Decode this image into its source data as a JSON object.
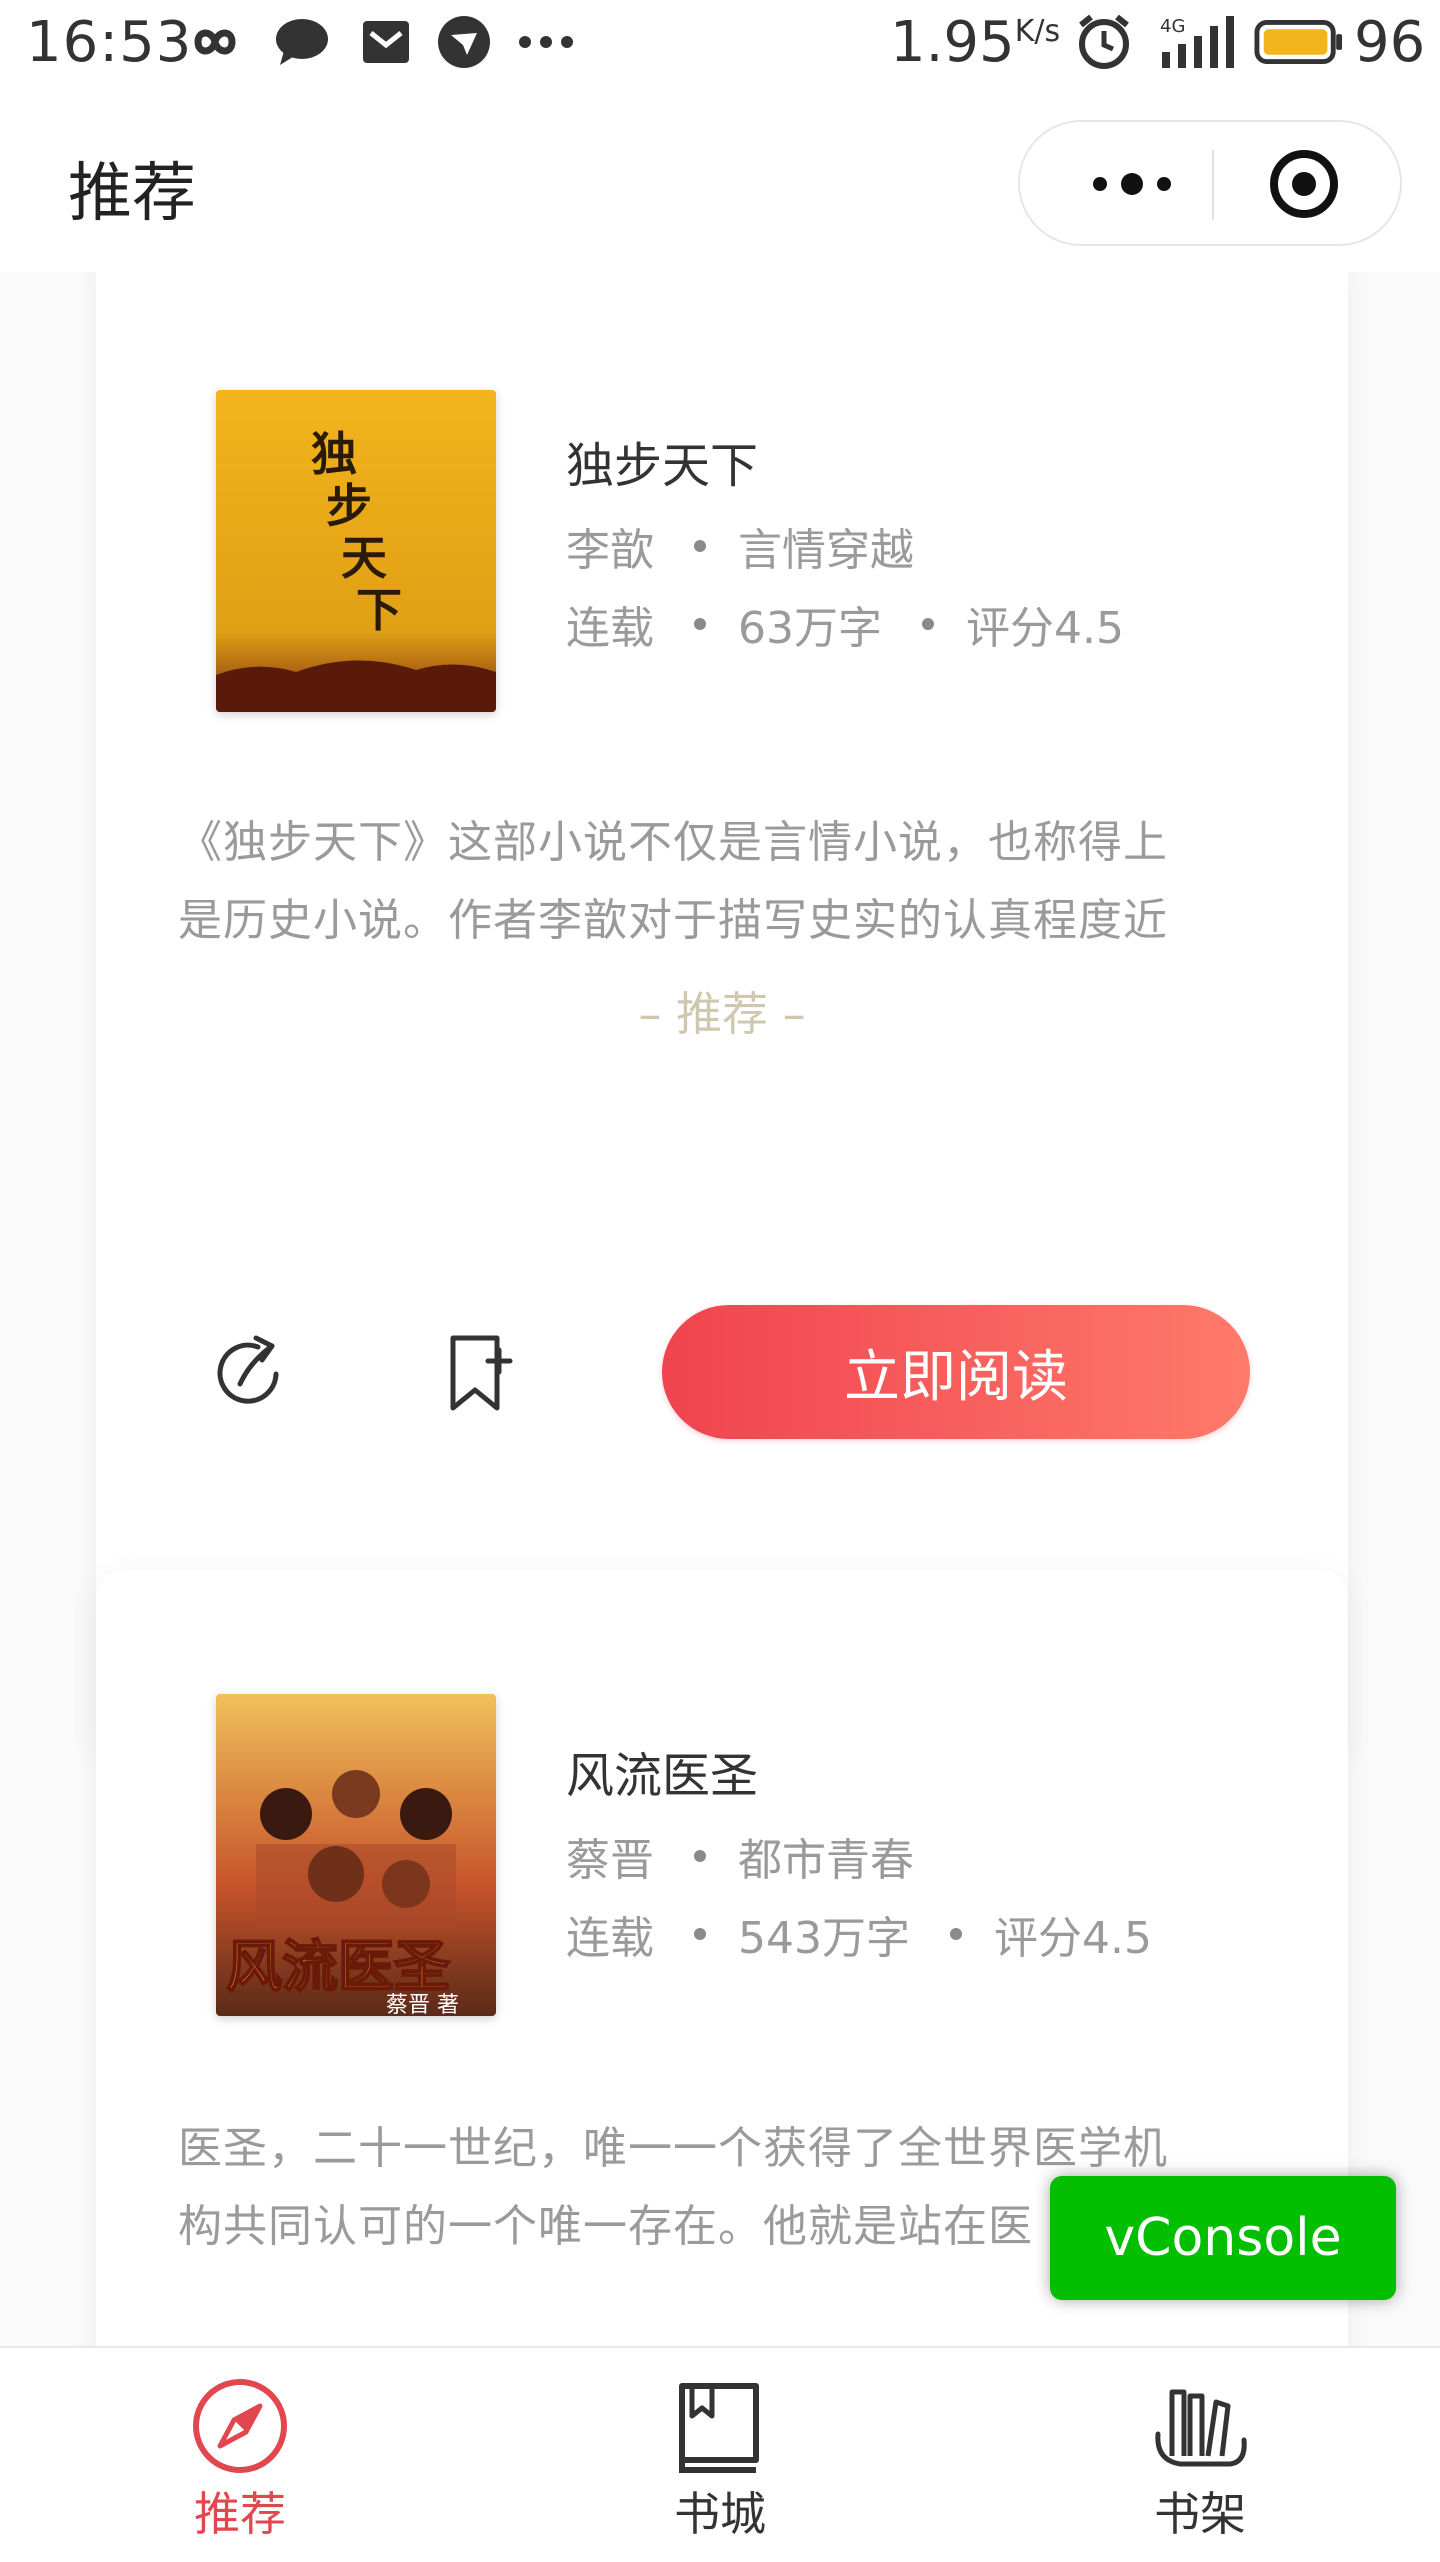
{
  "status_bar": {
    "time": "16:53",
    "speed_value": "1.95",
    "speed_unit": "K/s",
    "network": "4G",
    "battery": "96",
    "icons": [
      "infinity-icon",
      "chat-bubble-icon",
      "mail-icon",
      "bird-app-icon",
      "more-dots-icon",
      "alarm-icon",
      "signal-icon",
      "battery-icon"
    ]
  },
  "nav": {
    "title": "推荐",
    "capsule": {
      "more_icon": "more-dots-icon",
      "close_icon": "target-icon"
    }
  },
  "books": [
    {
      "title": "独步天下",
      "author": "李歆",
      "category": "言情穿越",
      "status": "连载",
      "words": "63万字",
      "rating": "评分4.5",
      "desc_line1": "《独步天下》这部小说不仅是言情小说，也称得上",
      "desc_line2": "是历史小说。作者李歆对于描写史实的认真程度近",
      "tag": "– 推荐 –",
      "read_label": "立即阅读",
      "cover_colors": [
        "#f3b41c",
        "#d9960d",
        "#7a2a10"
      ]
    },
    {
      "title": "风流医圣",
      "author": "蔡晋",
      "category": "都市青春",
      "status": "连载",
      "words": "543万字",
      "rating": "评分4.5",
      "desc_line1": "医圣，二十一世纪，唯一一个获得了全世界医学机",
      "desc_line2": "构共同认可的一个唯一存在。他就是站在医",
      "cover_colors": [
        "#f1c05a",
        "#c6532a",
        "#5a2a18"
      ]
    }
  ],
  "vconsole": {
    "label": "vConsole",
    "color": "#04be02"
  },
  "tabbar": {
    "items": [
      {
        "label": "推荐",
        "icon": "compass-icon",
        "active": true
      },
      {
        "label": "书城",
        "icon": "book-icon",
        "active": false
      },
      {
        "label": "书架",
        "icon": "bookshelf-icon",
        "active": false
      }
    ],
    "active_color": "#e0474f"
  }
}
